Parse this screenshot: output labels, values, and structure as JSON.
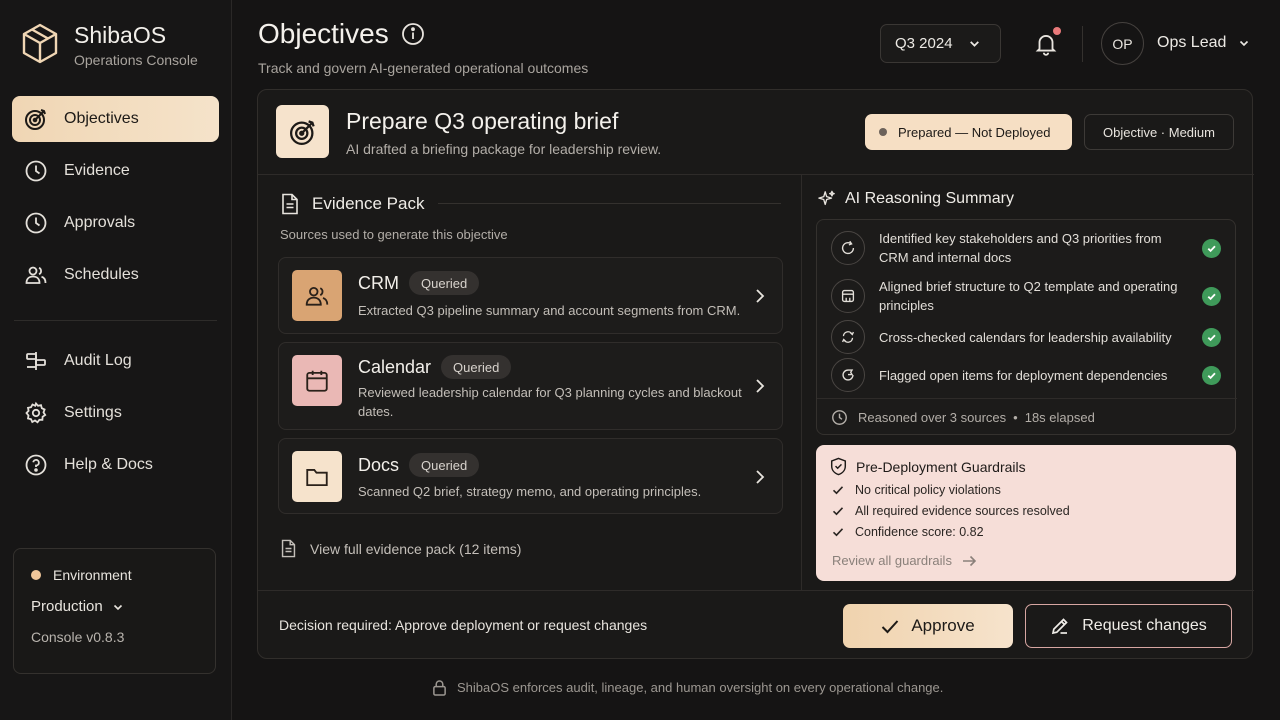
{
  "brand": {
    "name": "ShibaOS",
    "subtitle": "Operations Console"
  },
  "sidebar": {
    "items": [
      {
        "label": "Objectives",
        "icon": "target-icon",
        "active": true
      },
      {
        "label": "Evidence",
        "icon": "clock-icon"
      },
      {
        "label": "Approvals",
        "icon": "clock-icon"
      },
      {
        "label": "Schedules",
        "icon": "users-icon"
      },
      {
        "label": "Audit Log",
        "icon": "audit-icon"
      },
      {
        "label": "Settings",
        "icon": "gear-icon"
      },
      {
        "label": "Help & Docs",
        "icon": "help-icon"
      }
    ],
    "environment": {
      "label": "Environment",
      "value": "Production",
      "version": "Console v0.8.3"
    }
  },
  "header": {
    "title": "Objectives",
    "subtitle": "Track and govern AI-generated operational outcomes",
    "period": "Q3 2024",
    "user": {
      "initials": "OP",
      "name": "Ops Lead"
    }
  },
  "objective": {
    "title": "Prepare Q3 operating brief",
    "subtitle": "AI drafted a briefing package for leadership review.",
    "status": "Prepared — Not Deployed",
    "type": "Objective · Medium"
  },
  "evidence": {
    "title": "Evidence Pack",
    "subtitle": "Sources used to generate this objective",
    "sources": [
      {
        "name": "CRM",
        "status": "Queried",
        "description": "Extracted Q3 pipeline summary and account segments from CRM.",
        "color": "#d9a473"
      },
      {
        "name": "Calendar",
        "status": "Queried",
        "description": "Reviewed leadership calendar for Q3 planning cycles and blackout dates.",
        "color": "#eab8b5"
      },
      {
        "name": "Docs",
        "status": "Queried",
        "description": "Scanned Q2 brief, strategy memo, and operating principles.",
        "color": "#f6e3cc"
      }
    ],
    "view_full": "View full evidence pack (12 items)"
  },
  "reasoning": {
    "title": "AI Reasoning Summary",
    "steps": [
      "Identified key stakeholders and Q3 priorities from CRM and internal docs",
      "Aligned brief structure to Q2 template and operating principles",
      "Cross-checked calendars for leadership availability",
      "Flagged open items for deployment dependencies"
    ],
    "footer_sources": "Reasoned over 3 sources",
    "footer_elapsed": "18s elapsed"
  },
  "guardrails": {
    "title": "Pre-Deployment Guardrails",
    "items": [
      "No critical policy violations",
      "All required evidence sources resolved",
      "Confidence score: 0.82"
    ],
    "review": "Review all guardrails"
  },
  "decision": {
    "prompt": "Decision required: Approve deployment or request changes",
    "approve": "Approve",
    "request": "Request changes"
  },
  "footer": "ShibaOS enforces audit, lineage, and human oversight on every operational change.",
  "colors": {
    "accent": "#f0d6b4",
    "success": "#3f9a5a",
    "guardrail_bg": "#f6ded8",
    "notification": "#e8797a"
  }
}
